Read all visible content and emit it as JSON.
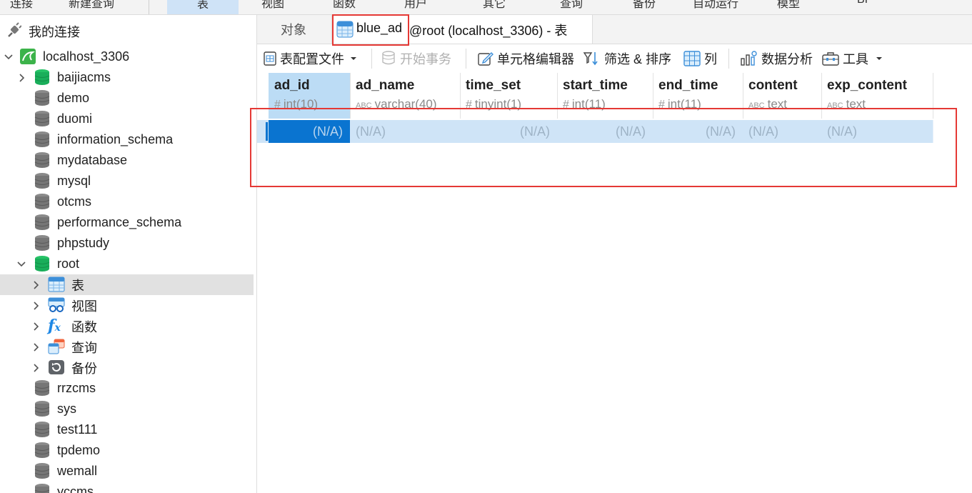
{
  "menubar": {
    "items": [
      "连接",
      "新建查询",
      "表",
      "视图",
      "函数",
      "用户",
      "其它",
      "查询",
      "备份",
      "自动运行",
      "模型",
      "BI"
    ],
    "active_index": 2
  },
  "sidebar": {
    "header": "我的连接",
    "connection": "localhost_3306",
    "databases": [
      {
        "name": "baijiacms",
        "expanded": false,
        "open": true
      },
      {
        "name": "demo"
      },
      {
        "name": "duomi"
      },
      {
        "name": "information_schema"
      },
      {
        "name": "mydatabase"
      },
      {
        "name": "mysql"
      },
      {
        "name": "otcms"
      },
      {
        "name": "performance_schema"
      },
      {
        "name": "phpstudy"
      },
      {
        "name": "root",
        "expanded": true,
        "open": true
      }
    ],
    "root_children": [
      {
        "label": "表",
        "icon": "table-icon",
        "selected": true
      },
      {
        "label": "视图",
        "icon": "view-icon"
      },
      {
        "label": "函数",
        "icon": "function-icon"
      },
      {
        "label": "查询",
        "icon": "query-icon"
      },
      {
        "label": "备份",
        "icon": "backup-icon"
      }
    ],
    "more_databases": [
      "rrzcms",
      "sys",
      "test111",
      "tpdemo",
      "wemall",
      "yccms"
    ]
  },
  "tabs": {
    "objects": "对象",
    "active_table": "blue_ad",
    "active_suffix": "@root (localhost_3306) - 表"
  },
  "toolbar": {
    "table_profile": "表配置文件",
    "begin_transaction": "开始事务",
    "cell_editor": "单元格编辑器",
    "filter_sort": "筛选 & 排序",
    "columns": "列",
    "data_analysis": "数据分析",
    "tools": "工具"
  },
  "table": {
    "columns": [
      {
        "name": "ad_id",
        "type": "int(10)",
        "kind": "number"
      },
      {
        "name": "ad_name",
        "type": "varchar(40)",
        "kind": "text"
      },
      {
        "name": "time_set",
        "type": "tinyint(1)",
        "kind": "number"
      },
      {
        "name": "start_time",
        "type": "int(11)",
        "kind": "number"
      },
      {
        "name": "end_time",
        "type": "int(11)",
        "kind": "number"
      },
      {
        "name": "content",
        "type": "text",
        "kind": "text"
      },
      {
        "name": "exp_content",
        "type": "text",
        "kind": "text"
      }
    ],
    "row": [
      "(N/A)",
      "(N/A)",
      "(N/A)",
      "(N/A)",
      "(N/A)",
      "(N/A)",
      "(N/A)"
    ]
  },
  "colors": {
    "accent": "#0a74d0",
    "highlight_box": "#e53935",
    "db_open": "#1aae5a",
    "db_closed": "#7a7a7a"
  }
}
